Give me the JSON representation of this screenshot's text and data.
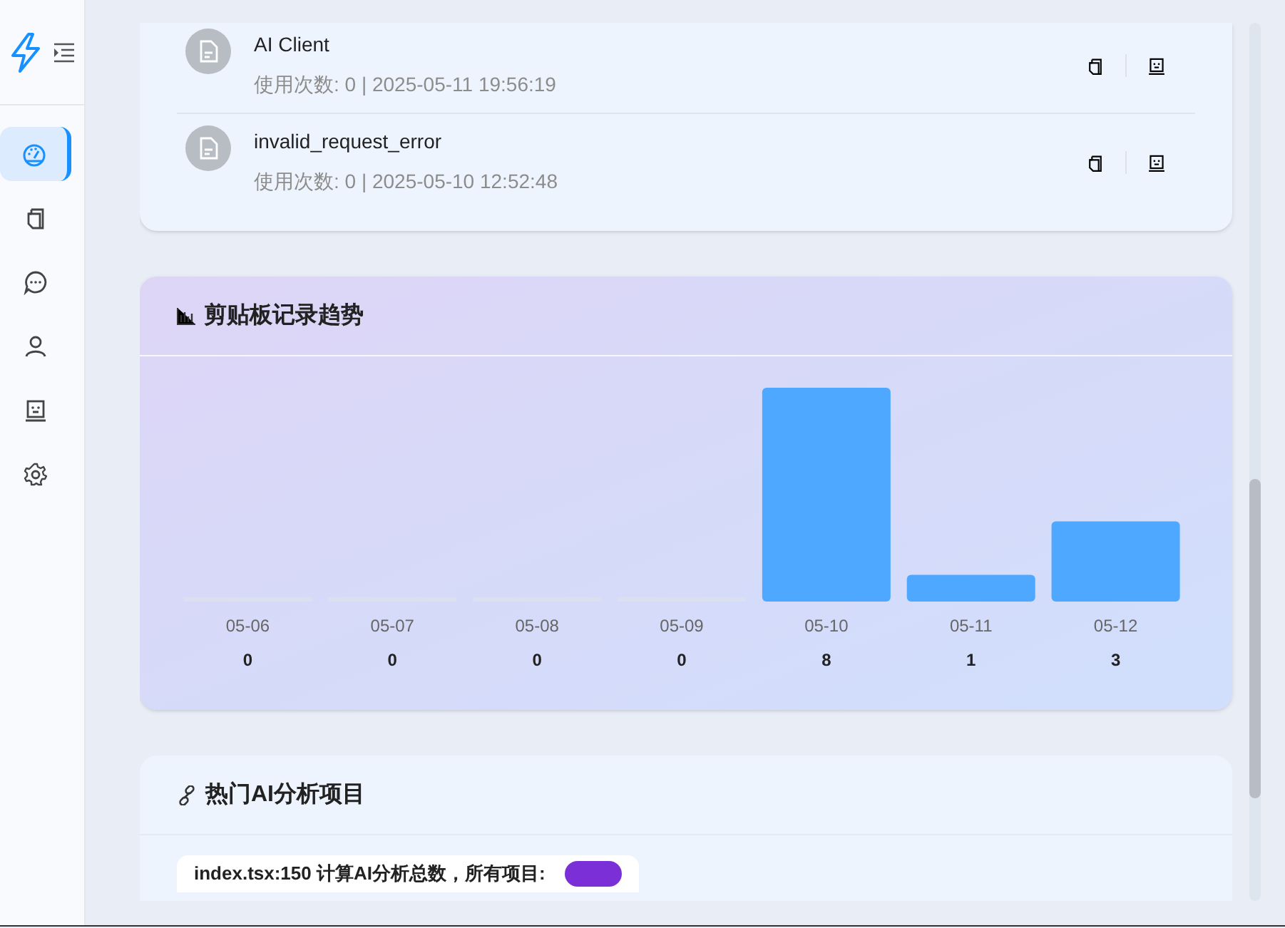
{
  "sidebar": {
    "items": [
      {
        "selected": true
      },
      {
        "selected": false
      },
      {
        "selected": false
      },
      {
        "selected": false
      },
      {
        "selected": false
      },
      {
        "selected": false
      }
    ]
  },
  "recent_items": [
    {
      "title": "AI Client",
      "meta": "使用次数: 0 | 2025-05-11 19:56:19"
    },
    {
      "title": "invalid_request_error",
      "meta": "使用次数: 0 | 2025-05-10 12:52:48"
    }
  ],
  "trend_card": {
    "title": "剪贴板记录趋势",
    "chart_data": {
      "type": "bar",
      "categories": [
        "05-06",
        "05-07",
        "05-08",
        "05-09",
        "05-10",
        "05-11",
        "05-12"
      ],
      "values": [
        0,
        0,
        0,
        0,
        8,
        1,
        3
      ],
      "data_labels": true
    }
  },
  "hot_card": {
    "title": "热门AI分析项目",
    "items": [
      {
        "text": "index.tsx:150 计算AI分析总数，所有项目:"
      }
    ]
  }
}
